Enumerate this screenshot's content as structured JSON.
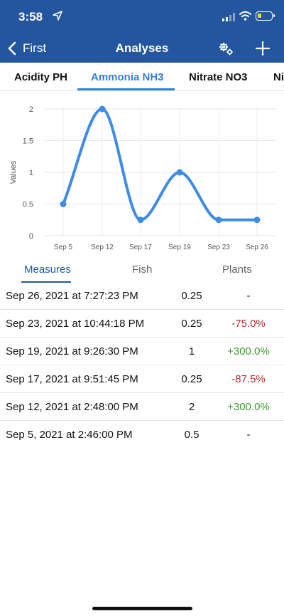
{
  "status_bar": {
    "time": "3:58"
  },
  "nav": {
    "back_label": "First",
    "title": "Analyses"
  },
  "tabs": [
    {
      "label": "Acidity PH",
      "active": false
    },
    {
      "label": "Ammonia NH3",
      "active": true
    },
    {
      "label": "Nitrate NO3",
      "active": false
    },
    {
      "label": "Ni",
      "active": false
    }
  ],
  "chart_data": {
    "type": "line",
    "categories": [
      "Sep 5",
      "Sep 12",
      "Sep 17",
      "Sep 19",
      "Sep 23",
      "Sep 26"
    ],
    "series": [
      {
        "values": [
          0.5,
          2,
          0.25,
          1,
          0.25,
          0.25
        ]
      }
    ],
    "ylabel": "Values",
    "xlabel": "",
    "ylim": [
      0,
      2
    ],
    "yticks": [
      "0",
      "0.5",
      "1",
      "1.5",
      "2"
    ],
    "grid": true,
    "color": "#3e8be8"
  },
  "segments": [
    {
      "label": "Measures",
      "active": true
    },
    {
      "label": "Fish",
      "active": false
    },
    {
      "label": "Plants",
      "active": false
    }
  ],
  "measures": [
    {
      "date": "Sep 26, 2021 at 7:27:23 PM",
      "value": "0.25",
      "change": "-",
      "trend": "none"
    },
    {
      "date": "Sep 23, 2021 at 10:44:18 PM",
      "value": "0.25",
      "change": "-75.0%",
      "trend": "down"
    },
    {
      "date": "Sep 19, 2021 at 9:26:30 PM",
      "value": "1",
      "change": "+300.0%",
      "trend": "up"
    },
    {
      "date": "Sep 17, 2021 at 9:51:45 PM",
      "value": "0.25",
      "change": "-87.5%",
      "trend": "down"
    },
    {
      "date": "Sep 12, 2021 at 2:48:00 PM",
      "value": "2",
      "change": "+300.0%",
      "trend": "up"
    },
    {
      "date": "Sep 5, 2021 at 2:46:00 PM",
      "value": "0.5",
      "change": "-",
      "trend": "none"
    }
  ],
  "colors": {
    "header": "#23569f",
    "accent": "#2f7fe0",
    "line": "#3e8be8",
    "negative": "#b3302c",
    "positive": "#3a9a2c"
  }
}
